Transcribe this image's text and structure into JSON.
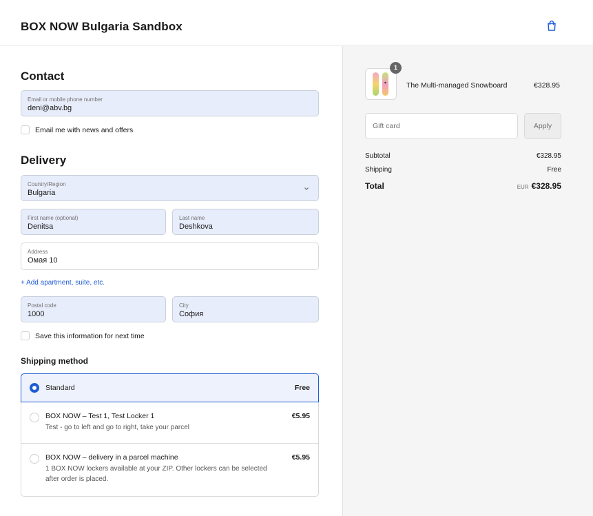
{
  "header": {
    "title": "BOX NOW Bulgaria Sandbox",
    "cart_icon": "shopping-bag-icon"
  },
  "contact": {
    "heading": "Contact",
    "email": {
      "label": "Email or mobile phone number",
      "value": "deni@abv.bg"
    },
    "newsletter_label": "Email me with news and offers",
    "newsletter_checked": false
  },
  "delivery": {
    "heading": "Delivery",
    "country": {
      "label": "Country/Region",
      "value": "Bulgaria"
    },
    "first_name": {
      "label": "First name (optional)",
      "value": "Denitsa"
    },
    "last_name": {
      "label": "Last name",
      "value": "Deshkova"
    },
    "address": {
      "label": "Address",
      "value": "Омая 10"
    },
    "add_apartment": "+ Add apartment, suite, etc.",
    "postal_code": {
      "label": "Postal code",
      "value": "1000"
    },
    "city": {
      "label": "City",
      "value": "София"
    },
    "save_info_label": "Save this information for next time",
    "save_info_checked": false
  },
  "shipping": {
    "heading": "Shipping method",
    "options": [
      {
        "name": "Standard",
        "description": "",
        "price": "Free",
        "selected": true
      },
      {
        "name": "BOX NOW – Test 1, Test Locker 1",
        "description": "Test - go to left and go to right, take your parcel",
        "price": "€5.95",
        "selected": false
      },
      {
        "name": "BOX NOW – delivery in a parcel machine",
        "description": "1 BOX NOW lockers available at your ZIP. Other lockers can be selected after order is placed.",
        "price": "€5.95",
        "selected": false
      }
    ]
  },
  "summary": {
    "product": {
      "name": "The Multi-managed Snowboard",
      "price": "€328.95",
      "quantity": "1"
    },
    "gift_card_placeholder": "Gift card",
    "apply_label": "Apply",
    "subtotal_label": "Subtotal",
    "subtotal_value": "€328.95",
    "shipping_label": "Shipping",
    "shipping_value": "Free",
    "total_label": "Total",
    "total_currency": "EUR",
    "total_value": "€328.95"
  },
  "colors": {
    "accent": "#1f5bd6",
    "field_fill": "#e8edfb",
    "summary_bg": "#f5f5f5"
  }
}
